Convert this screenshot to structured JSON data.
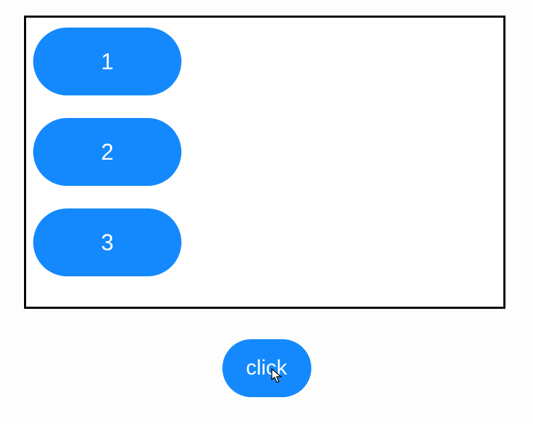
{
  "items": [
    {
      "label": "1"
    },
    {
      "label": "2"
    },
    {
      "label": "3"
    }
  ],
  "button": {
    "label": "click"
  }
}
